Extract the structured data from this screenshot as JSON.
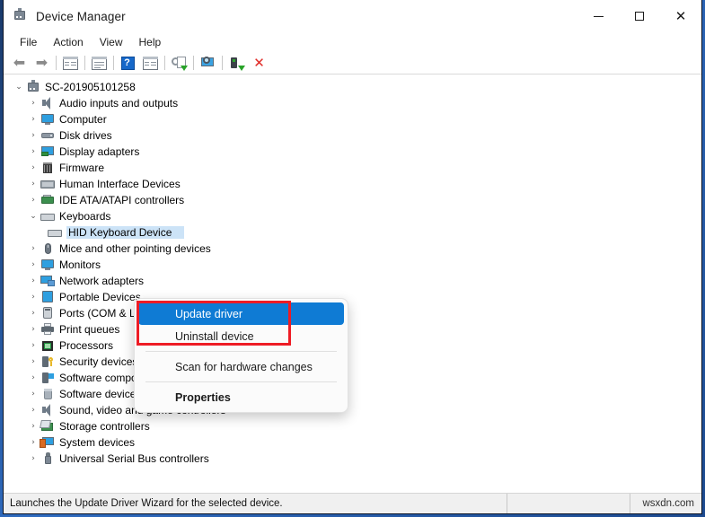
{
  "window": {
    "title": "Device Manager",
    "icon": "device-manager-icon",
    "controls": {
      "minimize": "—",
      "maximize": "□",
      "close": "✕"
    }
  },
  "menubar": {
    "items": [
      "File",
      "Action",
      "View",
      "Help"
    ]
  },
  "toolbar": {
    "items": [
      {
        "name": "back-icon",
        "glyph": "⬅"
      },
      {
        "name": "forward-icon",
        "glyph": "➡"
      },
      {
        "name": "separator-1",
        "glyph": ""
      },
      {
        "name": "show-hidden-devices-icon",
        "glyph": ""
      },
      {
        "name": "separator-2",
        "glyph": ""
      },
      {
        "name": "properties-icon",
        "glyph": ""
      },
      {
        "name": "separator-3",
        "glyph": ""
      },
      {
        "name": "help-icon",
        "glyph": "?"
      },
      {
        "name": "device-view-icon",
        "glyph": ""
      },
      {
        "name": "separator-4",
        "glyph": ""
      },
      {
        "name": "update-driver-icon",
        "glyph": ""
      },
      {
        "name": "separator-5",
        "glyph": ""
      },
      {
        "name": "scan-hardware-changes-icon",
        "glyph": ""
      },
      {
        "name": "separator-6",
        "glyph": ""
      },
      {
        "name": "enable-device-icon",
        "glyph": ""
      },
      {
        "name": "uninstall-device-icon",
        "glyph": "✕"
      }
    ]
  },
  "tree": {
    "root": {
      "label": "SC-201905101258",
      "icon": "computer-icon",
      "expanded": true
    },
    "nodes": [
      {
        "label": "Audio inputs and outputs",
        "icon": "speaker-icon",
        "depth": 1,
        "expanded": false
      },
      {
        "label": "Computer",
        "icon": "monitor-icon",
        "depth": 1,
        "expanded": false
      },
      {
        "label": "Disk drives",
        "icon": "disk-icon",
        "depth": 1,
        "expanded": false
      },
      {
        "label": "Display adapters",
        "icon": "display-adapter-icon",
        "depth": 1,
        "expanded": false
      },
      {
        "label": "Firmware",
        "icon": "firmware-icon",
        "depth": 1,
        "expanded": false
      },
      {
        "label": "Human Interface Devices",
        "icon": "hid-icon",
        "depth": 1,
        "expanded": false
      },
      {
        "label": "IDE ATA/ATAPI controllers",
        "icon": "ide-controller-icon",
        "depth": 1,
        "expanded": false
      },
      {
        "label": "Keyboards",
        "icon": "keyboard-icon",
        "depth": 1,
        "expanded": true
      },
      {
        "label": "HID Keyboard Device",
        "icon": "keyboard-icon",
        "depth": 2,
        "selected": true
      },
      {
        "label": "Mice and other pointing devices",
        "icon": "mouse-icon",
        "depth": 1,
        "expanded": false
      },
      {
        "label": "Monitors",
        "icon": "monitor-icon",
        "depth": 1,
        "expanded": false
      },
      {
        "label": "Network adapters",
        "icon": "network-adapter-icon",
        "depth": 1,
        "expanded": false
      },
      {
        "label": "Portable Devices",
        "icon": "portable-device-icon",
        "depth": 1,
        "expanded": false
      },
      {
        "label": "Ports (COM & LPT)",
        "icon": "port-icon",
        "depth": 1,
        "expanded": false
      },
      {
        "label": "Print queues",
        "icon": "printer-icon",
        "depth": 1,
        "expanded": false
      },
      {
        "label": "Processors",
        "icon": "processor-icon",
        "depth": 1,
        "expanded": false
      },
      {
        "label": "Security devices",
        "icon": "security-device-icon",
        "depth": 1,
        "expanded": false
      },
      {
        "label": "Software components",
        "icon": "software-component-icon",
        "depth": 1,
        "expanded": false
      },
      {
        "label": "Software devices",
        "icon": "software-device-icon",
        "depth": 1,
        "expanded": false
      },
      {
        "label": "Sound, video and game controllers",
        "icon": "speaker-icon",
        "depth": 1,
        "expanded": false
      },
      {
        "label": "Storage controllers",
        "icon": "storage-controller-icon",
        "depth": 1,
        "expanded": false
      },
      {
        "label": "System devices",
        "icon": "system-device-icon",
        "depth": 1,
        "expanded": false
      },
      {
        "label": "Universal Serial Bus controllers",
        "icon": "usb-icon",
        "depth": 1,
        "expanded": false
      }
    ],
    "expanded_glyph": "⌄",
    "collapsed_glyph": "›"
  },
  "context_menu": {
    "items": [
      {
        "label": "Update driver",
        "highlighted": true,
        "bold": false
      },
      {
        "label": "Uninstall device",
        "highlighted": false,
        "bold": false
      },
      {
        "label": "Scan for hardware changes",
        "highlighted": false,
        "bold": false
      },
      {
        "label": "Properties",
        "highlighted": false,
        "bold": true
      }
    ]
  },
  "annotation": {
    "highlight_color": "#ee1c25"
  },
  "statusbar": {
    "text": "Launches the Update Driver Wizard for the selected device.",
    "watermark": "wsxdn.com"
  },
  "colors": {
    "selection": "#cce3f7",
    "menu_highlight": "#0f7bd4",
    "annotation_red": "#ee1c25"
  }
}
